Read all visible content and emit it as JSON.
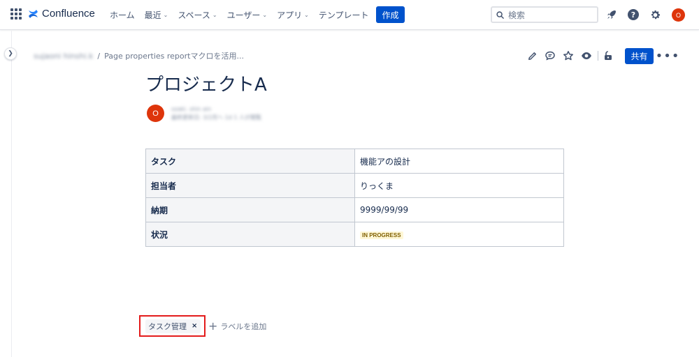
{
  "topnav": {
    "app_name": "Confluence",
    "items": [
      {
        "label": "ホーム",
        "dropdown": false
      },
      {
        "label": "最近",
        "dropdown": true
      },
      {
        "label": "スペース",
        "dropdown": true
      },
      {
        "label": "ユーザー",
        "dropdown": true
      },
      {
        "label": "アプリ",
        "dropdown": true
      },
      {
        "label": "テンプレート",
        "dropdown": false
      }
    ],
    "create_label": "作成",
    "search_placeholder": "検索",
    "avatar_initial": "O",
    "icons": [
      "app-switcher-icon",
      "confluence-logo-icon",
      "search-icon",
      "rocket-icon",
      "help-icon",
      "settings-icon"
    ]
  },
  "breadcrumb": {
    "space": "sujaoni hinshi.k",
    "separator": "/",
    "parent": "Page properties reportマクロを活用..."
  },
  "page_actions": {
    "icons": [
      "edit-icon",
      "comment-icon",
      "star-icon",
      "watch-icon",
      "restrictions-icon"
    ],
    "share_label": "共有",
    "more_label": "•••"
  },
  "page": {
    "title": "プロジェクトA",
    "byline": {
      "avatar_initial": "O",
      "author": "ozaki. shin ain",
      "meta": "最終更新日: 3/2月へ 1d 1 人が閲覧"
    }
  },
  "properties": [
    {
      "key": "タスク",
      "value": "機能アの設計",
      "status": false
    },
    {
      "key": "担当者",
      "value": "りっくま",
      "status": false
    },
    {
      "key": "納期",
      "value": "9999/99/99",
      "status": false
    },
    {
      "key": "状況",
      "value": "IN PROGRESS",
      "status": true
    }
  ],
  "labels": {
    "items": [
      "タスク管理"
    ],
    "remove_glyph": "×",
    "add_label": "ラベルを追加"
  },
  "colors": {
    "primary": "#0052cc",
    "avatar": "#de350b",
    "highlight": "#e31b1b",
    "lozenge_bg": "#fff7d6",
    "lozenge_text": "#7f5f01"
  }
}
